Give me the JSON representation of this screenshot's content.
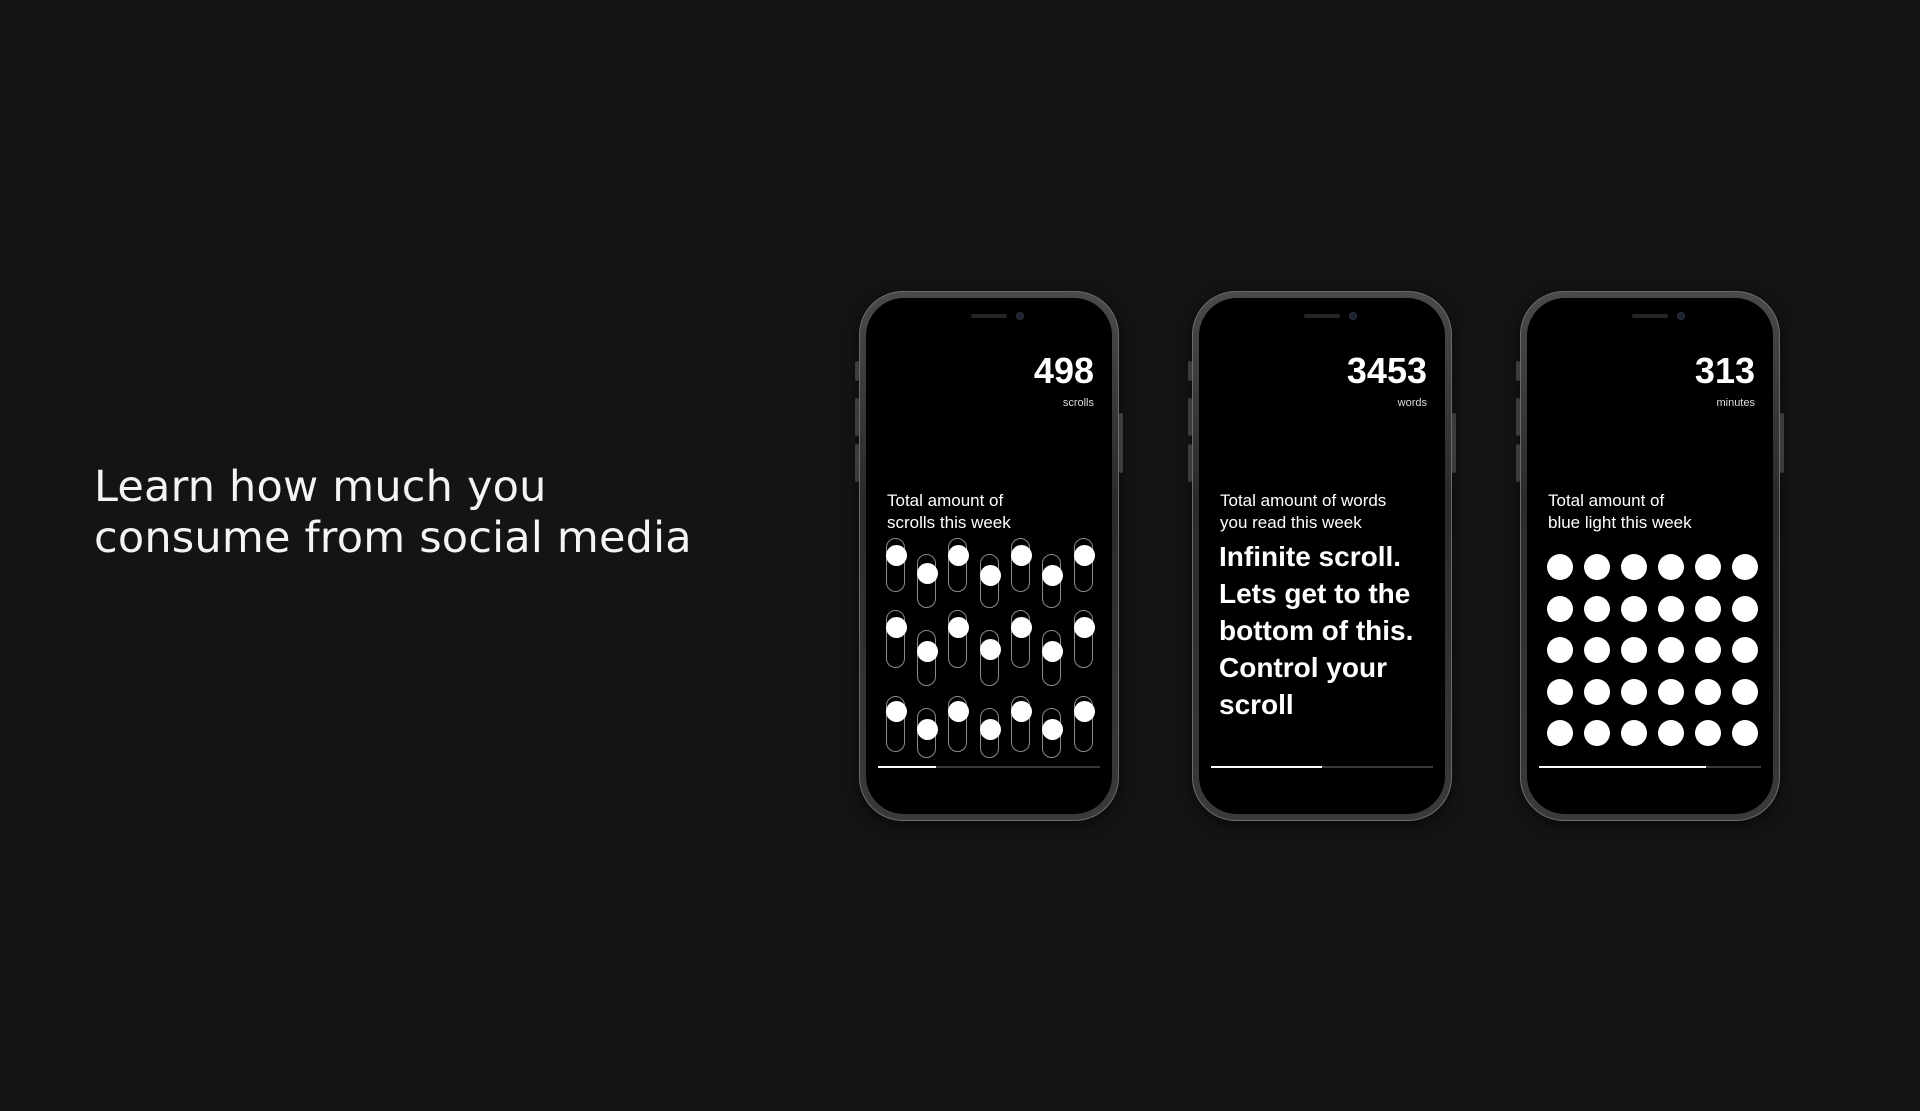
{
  "headline": {
    "line1": "Learn how much you",
    "line2": "consume from social media"
  },
  "phones": [
    {
      "count": "498",
      "unit": "scrolls",
      "desc_line1": "Total amount of",
      "desc_line2": "scrolls this week",
      "progress": 0.26
    },
    {
      "count": "3453",
      "unit": "words",
      "desc_line1": "Total amount of words",
      "desc_line2": "you read this week",
      "body_lines": [
        "Infinite scroll.",
        "Lets get to the",
        "bottom of this.",
        "Control your",
        "scroll"
      ],
      "progress": 0.5
    },
    {
      "count": "313",
      "unit": "minutes",
      "desc_line1": "Total amount of",
      "desc_line2": "blue light this week",
      "progress": 0.75
    }
  ],
  "colors": {
    "background": "#141414",
    "screen": "#000000",
    "accent": "#ffffff"
  }
}
